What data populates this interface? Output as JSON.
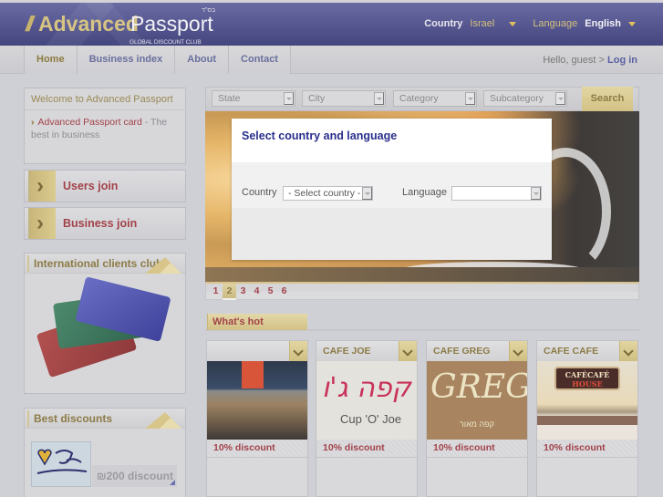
{
  "header": {
    "logo_slash": "//",
    "logo_advanced": "Advanced",
    "logo_passport": "Passport",
    "logo_tagline": "GLOBAL DISCOUNT CLUB",
    "logo_hebrew": "בס\"ד",
    "country_label": "Country",
    "country_value": "Israel",
    "language_label": "Language",
    "language_value": "English"
  },
  "nav": {
    "tabs": [
      {
        "label": "Home",
        "active": true
      },
      {
        "label": "Business index"
      },
      {
        "label": "About"
      },
      {
        "label": "Contact"
      }
    ],
    "greeting": "Hello, guest >",
    "login_label": "Log in"
  },
  "sidebar": {
    "welcome_title": "Welcome to Advanced Passport",
    "welcome_link": "Advanced Passport card",
    "welcome_text": " - The best in business",
    "users_join": "Users join",
    "business_join": "Business join",
    "intl_title": "International clients club",
    "best_title": "Best discounts",
    "best_discount": "₪200 discount"
  },
  "search": {
    "state": "State",
    "city": "City",
    "category": "Category",
    "subcategory": "Subcategory",
    "button": "Search"
  },
  "pager": {
    "pages": [
      "1",
      "2",
      "3",
      "4",
      "5",
      "6"
    ],
    "current": "2"
  },
  "modal": {
    "title": "Select country and language",
    "country_label": "Country",
    "country_value": "- Select country -",
    "language_label": "Language",
    "language_value": ""
  },
  "hot": {
    "title": "What's hot",
    "items": [
      {
        "name": "",
        "discount": "10% discount"
      },
      {
        "name": "CAFE JOE",
        "discount": "10% discount",
        "logo_text": "קפה ג'ו",
        "logo_sub": "Cup 'O' Joe"
      },
      {
        "name": "CAFE GREG",
        "discount": "10% discount",
        "logo_text": "GREG",
        "logo_sub": "קפה מאור"
      },
      {
        "name": "CAFE CAFE",
        "discount": "10% discount",
        "logo_text": "CAFÉCAFÉ",
        "logo_sub": "HOUSE"
      }
    ]
  },
  "colors": {
    "header_blue": "#55568f",
    "gold": "#d2c285",
    "accent_red": "#a2424a",
    "link_blue": "#5a60a0",
    "modal_title": "#2a2f8c"
  }
}
